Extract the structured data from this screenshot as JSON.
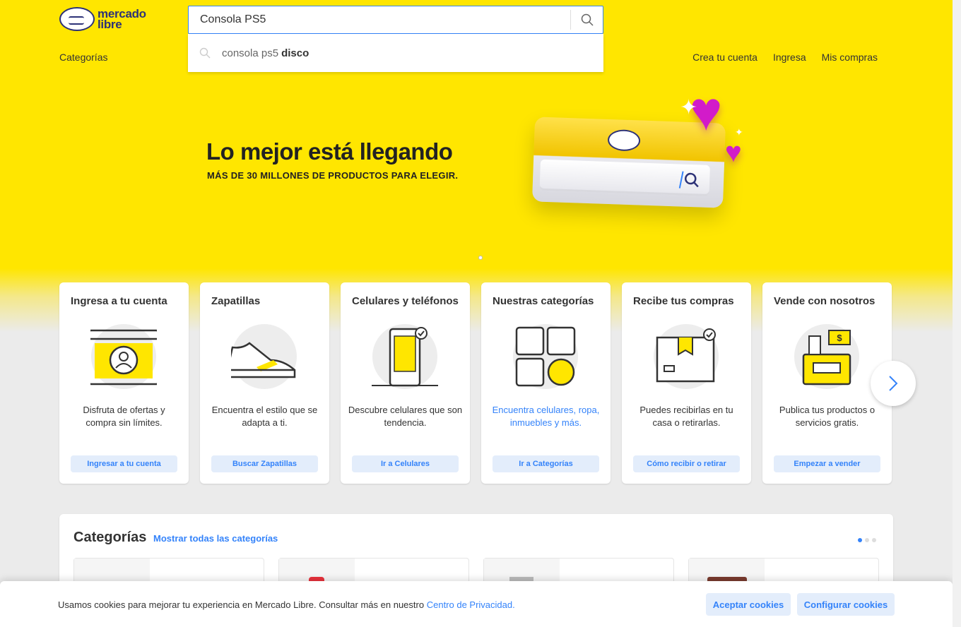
{
  "header": {
    "logo_line1": "mercado",
    "logo_line2": "libre",
    "search_value": "Consola PS5",
    "suggestion_prefix": "consola ps5",
    "suggestion_bold": "disco",
    "nav_categories": "Categorías",
    "nav_right": [
      "Crea tu cuenta",
      "Ingresa",
      "Mis compras"
    ]
  },
  "hero": {
    "title": "Lo mejor está llegando",
    "subtitle": "MÁS DE 30 MILLONES DE PRODUCTOS PARA ELEGIR."
  },
  "cards": [
    {
      "title": "Ingresa a tu cuenta",
      "desc": "Disfruta de ofertas y compra sin límites.",
      "button": "Ingresar a tu cuenta",
      "icon": "account-window-icon"
    },
    {
      "title": "Zapatillas",
      "desc": "Encuentra el estilo que se adapta a ti.",
      "button": "Buscar Zapatillas",
      "icon": "sneaker-icon"
    },
    {
      "title": "Celulares y teléfonos",
      "desc": "Descubre celulares que son tendencia.",
      "button": "Ir a Celulares",
      "icon": "phone-icon"
    },
    {
      "title": "Nuestras categorías",
      "desc": "Encuentra celulares, ropa, inmuebles y más.",
      "button": "Ir a Categorías",
      "icon": "categories-grid-icon"
    },
    {
      "title": "Recibe tus compras",
      "desc": "Puedes recibirlas en tu casa o retirarlas.",
      "button": "Cómo recibir o retirar",
      "icon": "package-box-icon"
    },
    {
      "title": "Vende con nosotros",
      "desc": "Publica tus productos o servicios gratis.",
      "button": "Empezar a vender",
      "icon": "store-register-icon"
    }
  ],
  "categories_section": {
    "title": "Categorías",
    "link": "Mostrar todas las categorías",
    "pages": 3,
    "active_page": 1
  },
  "cookie": {
    "text": "Usamos cookies para mejorar tu experiencia en Mercado Libre. Consultar más en nuestro",
    "link": "Centro de Privacidad.",
    "accept": "Aceptar cookies",
    "configure": "Configurar cookies"
  },
  "colors": {
    "brand_yellow": "#ffe600",
    "accent_blue": "#3483fa",
    "navy": "#2d3277"
  }
}
